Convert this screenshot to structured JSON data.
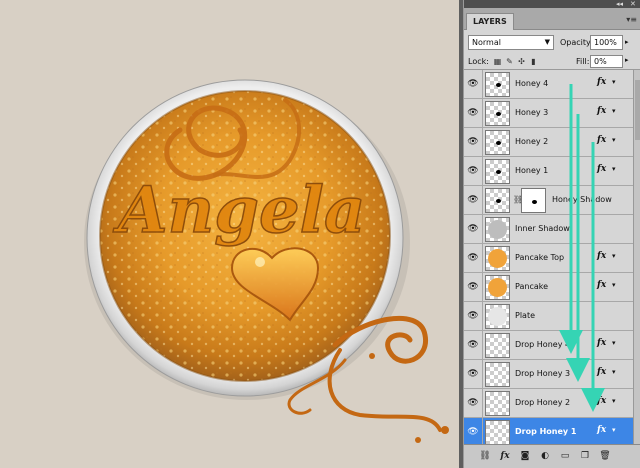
{
  "canvas": {
    "name_text": "Angela"
  },
  "panel": {
    "tab_label": "LAYERS",
    "collapse_icon": "double-chevron-icon",
    "close_icon": "close-icon",
    "menu_icon": "panel-menu-icon",
    "blend_mode": "Normal",
    "opacity_label": "Opacity:",
    "opacity_value": "100%",
    "lock_label": "Lock:",
    "fill_label": "Fill:",
    "fill_value": "0%"
  },
  "layers": [
    {
      "name": "Honey 4",
      "thumb": "transparent-heart",
      "fx": true
    },
    {
      "name": "Honey 3",
      "thumb": "transparent-heart",
      "fx": true
    },
    {
      "name": "Honey 2",
      "thumb": "transparent-heart",
      "fx": true
    },
    {
      "name": "Honey 1",
      "thumb": "transparent-heart",
      "fx": true
    },
    {
      "name": "Honey Shadow",
      "thumb": "transparent-heart",
      "mask": true,
      "fx": false
    },
    {
      "name": "Inner Shadow",
      "thumb": "grey-disc",
      "fx": false
    },
    {
      "name": "Pancake Top",
      "thumb": "orange-disc",
      "fx": true
    },
    {
      "name": "Pancake",
      "thumb": "orange-disc",
      "fx": true
    },
    {
      "name": "Plate",
      "thumb": "light-disc",
      "fx": false
    },
    {
      "name": "Drop Honey 4",
      "thumb": "transparent",
      "fx": true
    },
    {
      "name": "Drop Honey 3",
      "thumb": "transparent",
      "fx": true
    },
    {
      "name": "Drop Honey 2",
      "thumb": "transparent",
      "fx": true
    },
    {
      "name": "Drop Honey 1",
      "thumb": "transparent",
      "fx": true,
      "selected": true
    }
  ],
  "bottom_bar": [
    "link-layers-icon",
    "fx-icon",
    "add-mask-icon",
    "adjustment-layer-icon",
    "new-group-icon",
    "new-layer-icon",
    "trash-icon"
  ],
  "colors": {
    "canvas_bg": "#d8d0c5",
    "panel_bg": "#d6d6d6",
    "selected_layer": "#3d86e6",
    "annotation_arrows": "#35d4b4",
    "honey": "#d98a1c"
  }
}
